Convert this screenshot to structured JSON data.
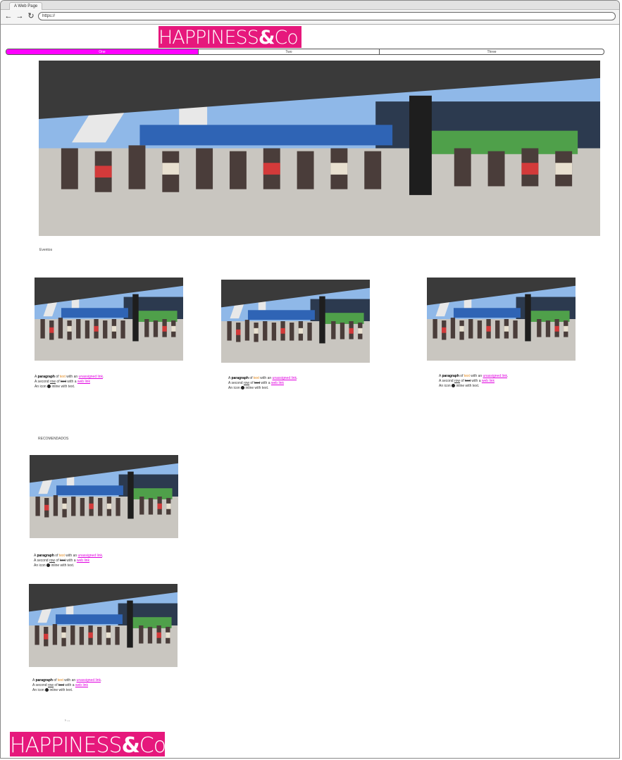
{
  "browser": {
    "tab_title": "A Web Page",
    "url": "https://",
    "back_icon": "arrow-left-icon",
    "forward_icon": "arrow-right-icon",
    "reload_icon": "reload-icon"
  },
  "brand": {
    "name": "HAPPINESS",
    "amp": "&",
    "suffix": "Co",
    "color": "#e6187c"
  },
  "nav": {
    "items": [
      "One",
      "Two",
      "Three"
    ],
    "active_index": 0,
    "active_color": "#ff00ff"
  },
  "sections": {
    "eventos": "Eventos",
    "recomendados": "RECOMENDADOS"
  },
  "card": {
    "p1_a": "A ",
    "p1_bold": "paragraph",
    "p1_b": " of ",
    "p1_orange": "text",
    "p1_c": " with an ",
    "p1_link": "unassigned link",
    "p1_end": ".",
    "p2_a": "A second ",
    "p2_underline": "row",
    "p2_b": " of ",
    "p2_strike": "text",
    "p2_c": " with a ",
    "p2_link": "web link",
    "p3_a": "An icon ",
    "p3_b": " inline with text."
  },
  "footer": {
    "more": "› ..."
  }
}
